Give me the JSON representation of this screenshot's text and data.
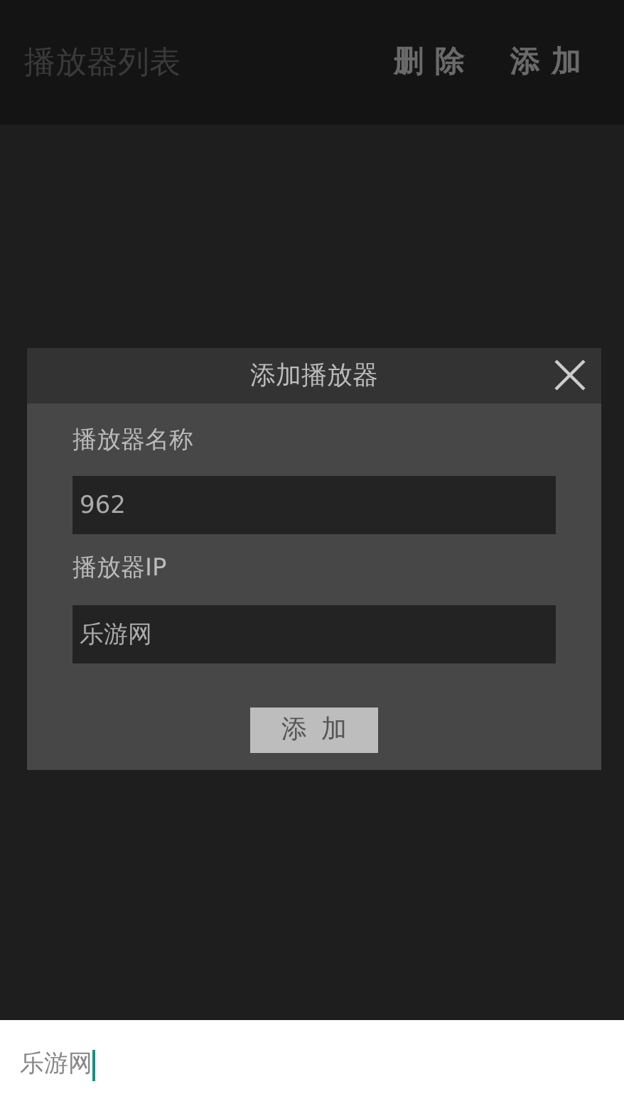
{
  "app_bar": {
    "title": "播放器列表",
    "actions": [
      {
        "label": "删除"
      },
      {
        "label": "添加"
      }
    ]
  },
  "dialog": {
    "title": "添加播放器",
    "fields": [
      {
        "label": "播放器名称",
        "value": "962"
      },
      {
        "label": "播放器IP",
        "value": "乐游网"
      }
    ],
    "button": "添加"
  },
  "input_bar": {
    "value": "乐游网"
  }
}
